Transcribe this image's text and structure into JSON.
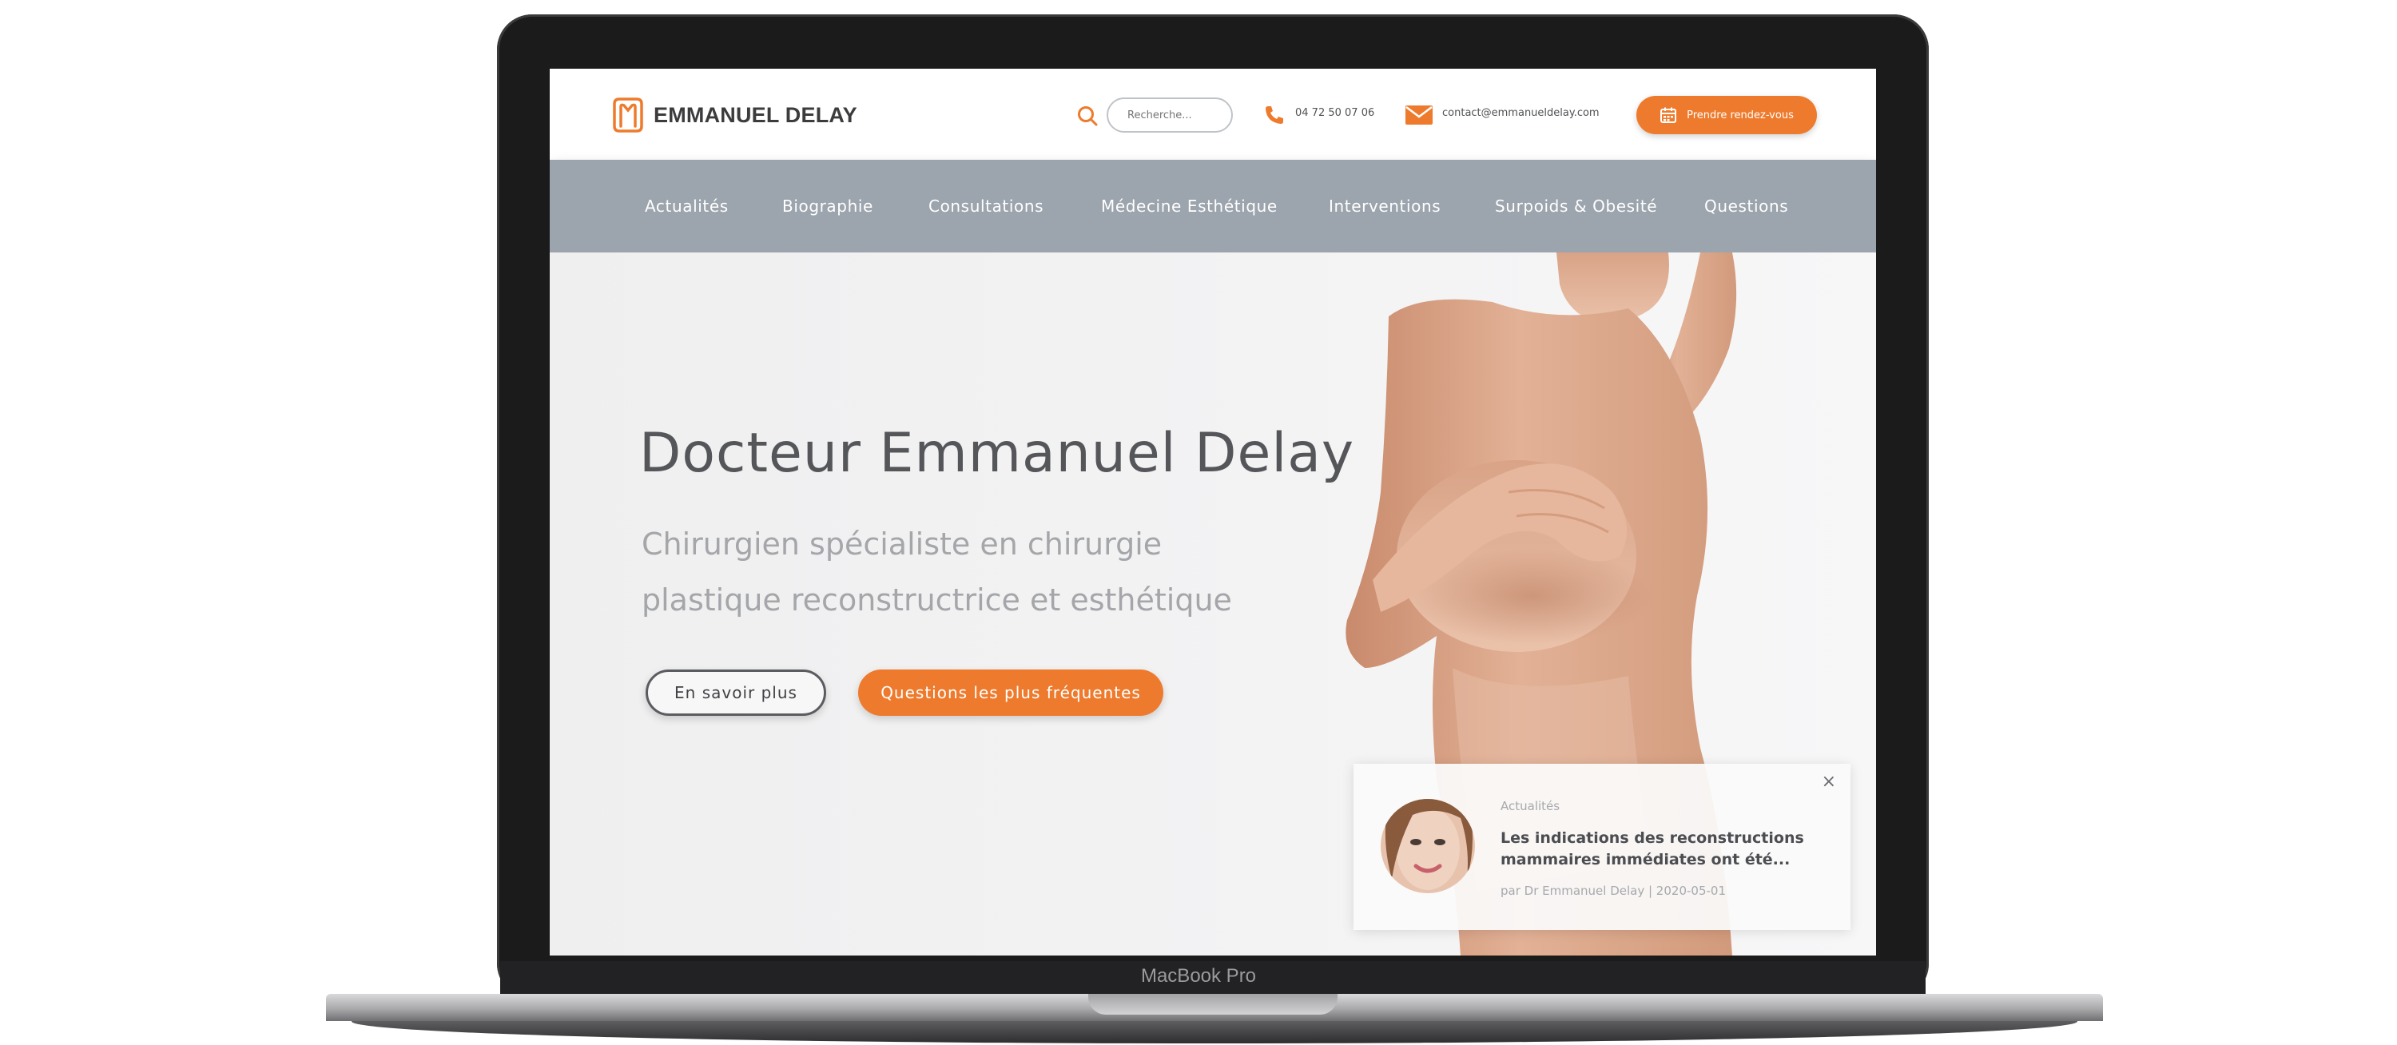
{
  "device": {
    "label": "MacBook Pro"
  },
  "header": {
    "brand": "EMMANUEL DELAY",
    "search_placeholder": "Recherche...",
    "phone": "04 72 50 07 06",
    "email": "contact@emmanueldelay.com",
    "cta_label": "Prendre rendez-vous"
  },
  "nav": {
    "items": [
      "Actualités",
      "Biographie",
      "Consultations",
      "Médecine Esthétique",
      "Interventions",
      "Surpoids & Obesité",
      "Questions"
    ]
  },
  "hero": {
    "title": "Docteur Emmanuel Delay",
    "subtitle": "Chirurgien spécialiste en chirurgie plastique reconstructrice et esthétique",
    "button_more": "En savoir plus",
    "button_faq": "Questions les plus fréquentes"
  },
  "news": {
    "close": "×",
    "category": "Actualités",
    "title": "Les indications des reconstructions mammaires immédiates ont été...",
    "meta": "par Dr Emmanuel Delay | 2020-05-01"
  },
  "colors": {
    "accent": "#ee7b2d",
    "nav_bg": "#9ca4ad",
    "text_dark": "#555659",
    "text_muted": "#a4a6a9"
  },
  "icons": {
    "logo": "logo-mark-icon",
    "search": "search-icon",
    "phone": "phone-icon",
    "mail": "mail-icon",
    "calendar": "calendar-icon",
    "close": "close-icon"
  }
}
